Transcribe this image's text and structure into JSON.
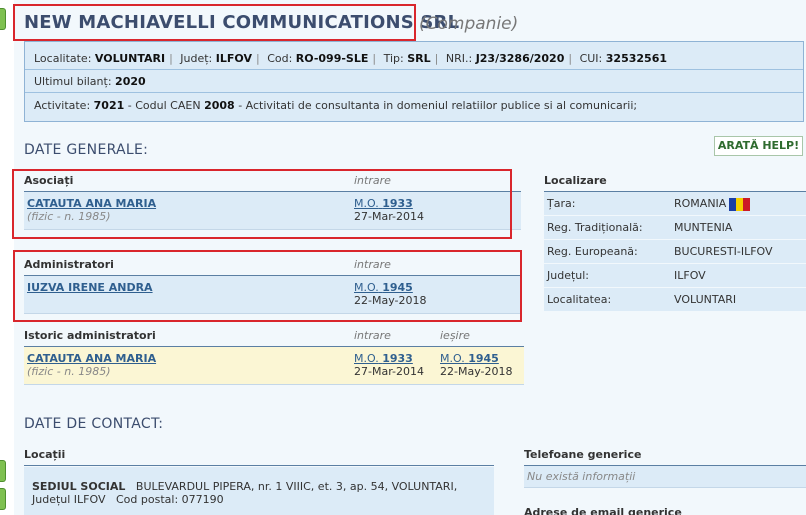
{
  "company": {
    "name": "NEW MACHIAVELLI COMMUNICATIONS SRL",
    "type": "(Companie)"
  },
  "info": {
    "localitate_label": "Localitate:",
    "localitate": "VOLUNTARI",
    "judet_label": "Județ:",
    "judet": "ILFOV",
    "cod_label": "Cod:",
    "cod": "RO-099-SLE",
    "tip_label": "Tip:",
    "tip": "SRL",
    "nri_label": "NRI.:",
    "nri": "J23/3286/2020",
    "cui_label": "CUI:",
    "cui": "32532561",
    "bilant_label": "Ultimul bilanț:",
    "bilant": "2020",
    "activitate_label": "Activitate:",
    "activitate_code": "7021",
    "caen_label": "- Codul CAEN",
    "caen_year": "2008",
    "activitate_desc": "- Activitati de consultanta in domeniul relatiilor publice si al comunicarii;"
  },
  "sections": {
    "general": "DATE GENERALE:",
    "contact": "DATE DE CONTACT:"
  },
  "help_button": "ARATĂ HELP!",
  "asociati": {
    "title": "Asociați",
    "col_in": "intrare",
    "rows": [
      {
        "name": "CATAUTA ANA MARIA",
        "note": "(fizic - n. 1985)",
        "mo_prefix": "M.O.",
        "mo_num": "1933",
        "date": "27-Mar-2014"
      }
    ]
  },
  "administratori": {
    "title": "Administratori",
    "col_in": "intrare",
    "rows": [
      {
        "name": "IUZVA IRENE ANDRA",
        "mo_prefix": "M.O.",
        "mo_num": "1945",
        "date": "22-May-2018"
      }
    ]
  },
  "istoric": {
    "title": "Istoric administratori",
    "col_in": "intrare",
    "col_out": "ieșire",
    "rows": [
      {
        "name": "CATAUTA ANA MARIA",
        "note": "(fizic - n. 1985)",
        "mo_prefix": "M.O.",
        "mo_in": "1933",
        "date_in": "27-Mar-2014",
        "mo_out": "1945",
        "date_out": "22-May-2018"
      }
    ]
  },
  "localizare": {
    "title": "Localizare",
    "rows": [
      {
        "k": "Țara:",
        "v": "ROMANIA"
      },
      {
        "k": "Reg. Tradițională:",
        "v": "MUNTENIA"
      },
      {
        "k": "Reg. Europeană:",
        "v": "BUCURESTI-ILFOV"
      },
      {
        "k": "Județul:",
        "v": "ILFOV"
      },
      {
        "k": "Localitatea:",
        "v": "VOLUNTARI"
      }
    ],
    "flag_colors": [
      "#1a3fa6",
      "#f5d000",
      "#cc1a26"
    ]
  },
  "contact": {
    "locatii_title": "Locații",
    "sediu_label": "SEDIUL SOCIAL",
    "sediu_addr": "BULEVARDUL PIPERA, nr. 1 VIIIC, et. 3, ap. 54, VOLUNTARI,",
    "sediu_addr2": "Județul ILFOV",
    "postal": "Cod postal: 077190",
    "telefoane_title": "Telefoane generice",
    "telefoane_empty": "Nu există informații",
    "email_title": "Adrese de email generice"
  },
  "colors": {
    "accent": "#3c4d6e",
    "highlight_box": "#d9262c",
    "panel_blue": "#dcebf7",
    "panel_yellow": "#fbf6d4"
  }
}
